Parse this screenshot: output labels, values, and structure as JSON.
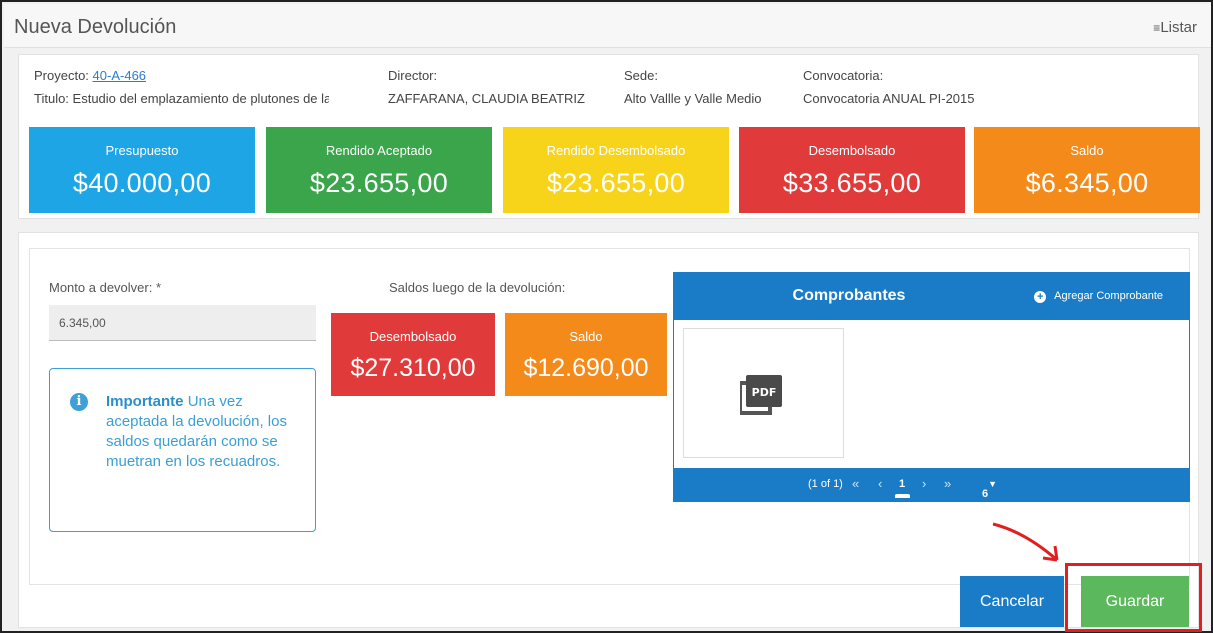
{
  "header": {
    "title": "Nueva Devolución",
    "listar_label": "Listar",
    "listar_icon": "list-icon"
  },
  "project": {
    "proyecto_label": "Proyecto:",
    "proyecto_code": "40-A-466",
    "titulo_label": "Titulo:",
    "titulo_value": "Estudio del emplazamiento de plutones de la C",
    "director_label": "Director:",
    "director_value": "ZAFFARANA, CLAUDIA BEATRIZ",
    "sede_label": "Sede:",
    "sede_value": "Alto Vallle y Valle Medio",
    "convocatoria_label": "Convocatoria:",
    "convocatoria_value": "Convocatoria ANUAL PI-2015"
  },
  "stats": [
    {
      "label": "Presupuesto",
      "value": "$40.000,00",
      "color": "#1ea5e6"
    },
    {
      "label": "Rendido Aceptado",
      "value": "$23.655,00",
      "color": "#3aa54a"
    },
    {
      "label": "Rendido Desembolsado",
      "value": "$23.655,00",
      "color": "#f7d31a"
    },
    {
      "label": "Desembolsado",
      "value": "$33.655,00",
      "color": "#e03a3a"
    },
    {
      "label": "Saldo",
      "value": "$6.345,00",
      "color": "#f48a1a"
    }
  ],
  "form": {
    "monto_label": "Monto a devolver: *",
    "monto_value": "6.345,00",
    "important_title": "Importante",
    "important_text": "Una vez aceptada la devolución, los saldos quedarán como se muetran en los recuadros.",
    "saldos_title": "Saldos luego de la devolución:",
    "after": [
      {
        "label": "Desembolsado",
        "value": "$27.310,00",
        "color": "#e03a3a"
      },
      {
        "label": "Saldo",
        "value": "$12.690,00",
        "color": "#f48a1a"
      }
    ]
  },
  "comprobantes": {
    "title": "Comprobantes",
    "add_label": "Agregar Comprobante",
    "file_icon": "pdf-icon",
    "pager": {
      "summary": "(1 of 1)",
      "first": "«",
      "prev": "‹",
      "page": "1",
      "next": "›",
      "last": "»",
      "rows": "6",
      "rows_caret": "▼"
    }
  },
  "actions": {
    "cancel_label": "Cancelar",
    "save_label": "Guardar"
  }
}
